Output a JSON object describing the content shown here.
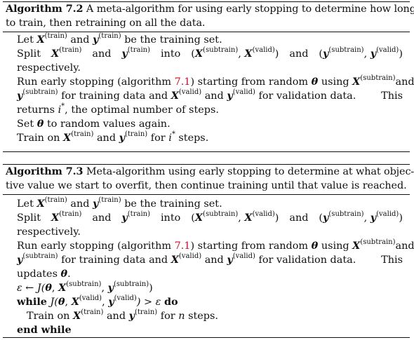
{
  "algorithm_7_2": {
    "label": "Algorithm 7.2",
    "caption_line1": "A meta-algorithm for using early stopping to determine how long",
    "caption_line2": "to train, then retraining on all the data.",
    "steps": {
      "let_prefix": "Let",
      "let_and": "and",
      "let_suffix": "be the training set.",
      "split_prefix": "Split",
      "split_and": "and",
      "split_into": "into",
      "split_and2": "and",
      "respectively": "respectively.",
      "run_prefix": "Run early stopping (algorithm",
      "run_ref": "7.1",
      "run_mid": ") starting from random",
      "run_using": "using",
      "run_and": "and",
      "run_for_training": "for training data and",
      "run_and2": "and",
      "run_for_validation": "for validation data.",
      "run_this": "This",
      "returns_prefix": "returns",
      "returns_suffix": ", the optimal number of steps.",
      "set_prefix": "Set",
      "set_suffix": "to random values again.",
      "train_prefix": "Train on",
      "train_and": "and",
      "train_for": "for",
      "train_steps": "steps."
    }
  },
  "algorithm_7_3": {
    "label": "Algorithm 7.3",
    "caption_line1": "Meta-algorithm using early stopping to determine at what objec-",
    "caption_line2": "tive value we start to overfit, then continue training until that value is reached.",
    "steps": {
      "let_prefix": "Let",
      "let_and": "and",
      "let_suffix": "be the training set.",
      "split_prefix": "Split",
      "split_and": "and",
      "split_into": "into",
      "split_and2": "and",
      "respectively": "respectively.",
      "run_prefix": "Run early stopping (algorithm",
      "run_ref": "7.1",
      "run_mid": ") starting from random",
      "run_using": "using",
      "run_and": "and",
      "run_for_training": "for training data and",
      "run_and2": "and",
      "run_for_validation": "for validation data.",
      "run_this": "This",
      "updates_prefix": "updates",
      "eps_assign": "ε ← J(",
      "while_kw": "while",
      "while_mid": "J(",
      "while_gt": ") > ε",
      "do_kw": "do",
      "train_prefix": "Train on",
      "train_and": "and",
      "train_for": "for",
      "train_n": "n",
      "train_steps": "steps.",
      "end_while_kw": "end while"
    }
  },
  "math": {
    "X": "X",
    "y": "y",
    "theta": "θ",
    "i_star": "i",
    "star": "*",
    "sup_train": "(train)",
    "sup_subtrain": "(subtrain)",
    "sup_valid": "(valid)",
    "lparen": "(",
    "rparen": ")",
    "comma": ",",
    "comma_space": ", ",
    "period": "."
  }
}
